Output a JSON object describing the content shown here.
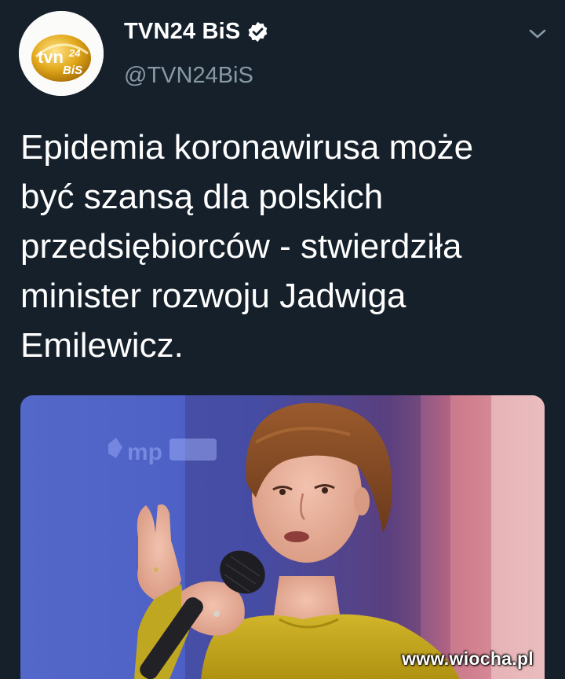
{
  "account": {
    "display_name": "TVN24 BiS",
    "handle": "@TVN24BiS",
    "verified": true,
    "avatar_logo_main": "tvn",
    "avatar_logo_number": "24",
    "avatar_logo_sub": "BiS"
  },
  "tweet": {
    "text": "Epidemia koronawirusa może\nbyć szansą dla polskich\nprzedsiębiorców - stwierdziła\nminister rozwoju Jadwiga\nEmilewicz."
  },
  "media": {
    "type": "photo",
    "subject": "woman-speaking-into-microphone"
  },
  "watermark": {
    "text": "www.wiocha.pl"
  },
  "icons": {
    "verified": "verified-badge-icon",
    "menu": "chevron-down-icon"
  },
  "colors": {
    "background": "#15202b",
    "text_primary": "#ffffff",
    "text_secondary": "#8899a6",
    "logo_gold": "#e0a81e"
  }
}
